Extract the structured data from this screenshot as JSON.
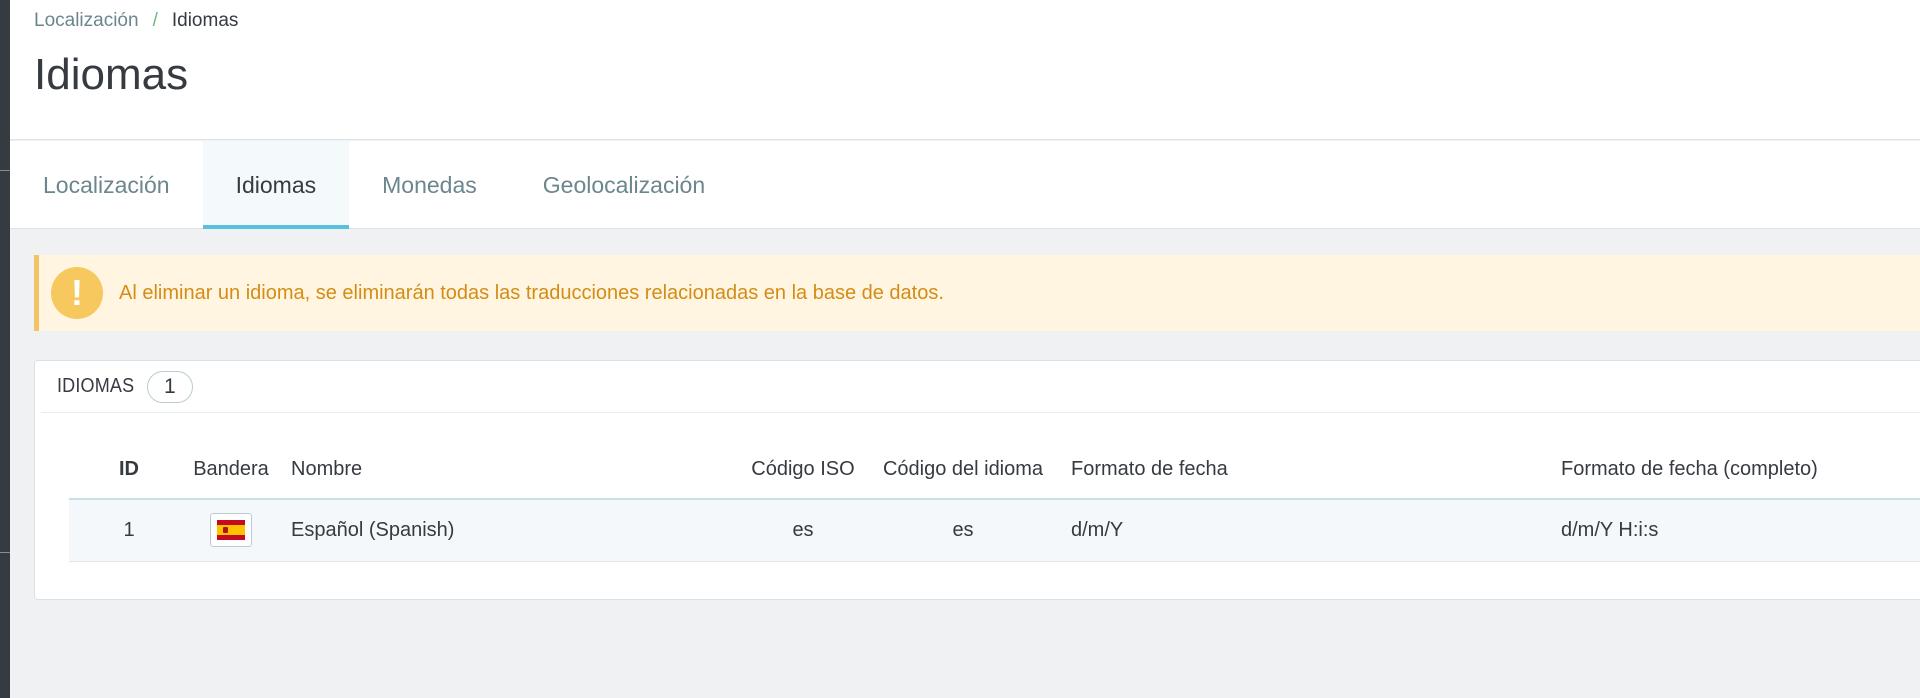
{
  "breadcrumb": {
    "parent": "Localización",
    "separator": "/",
    "current": "Idiomas"
  },
  "page_title": "Idiomas",
  "tabs": [
    {
      "label": "Localización",
      "active": false
    },
    {
      "label": "Idiomas",
      "active": true
    },
    {
      "label": "Monedas",
      "active": false
    },
    {
      "label": "Geolocalización",
      "active": false
    }
  ],
  "alert": {
    "icon": "warning-icon",
    "icon_glyph": "!",
    "text": "Al eliminar un idioma, se eliminarán todas las traducciones relacionadas en la base de datos.",
    "color": "#d58c16",
    "background": "#fff5e0"
  },
  "languages_panel": {
    "title": "IDIOMAS",
    "count": "1",
    "columns": {
      "id": "ID",
      "flag": "Bandera",
      "name": "Nombre",
      "iso": "Código ISO",
      "language_code": "Código del idioma",
      "date_format": "Formato de fecha",
      "date_format_full": "Formato de fecha (completo)"
    },
    "rows": [
      {
        "id": "1",
        "flag_icon": "spain-flag-icon",
        "name": "Español (Spanish)",
        "iso": "es",
        "language_code": "es",
        "date_format": "d/m/Y",
        "date_format_full": "d/m/Y H:i:s"
      }
    ]
  },
  "colors": {
    "active_tab_underline": "#5bc0de",
    "warning_icon": "#f7c85d"
  }
}
